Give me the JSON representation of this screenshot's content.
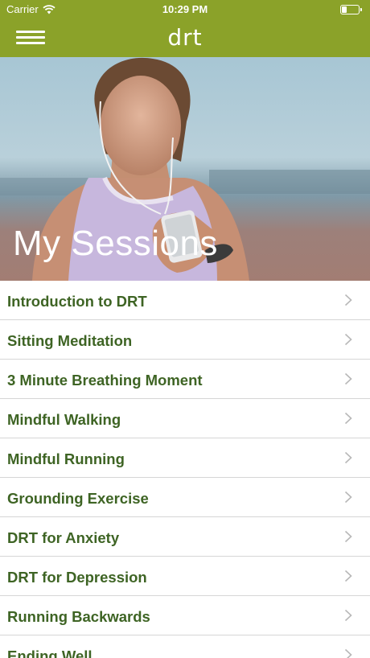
{
  "status_bar": {
    "carrier": "Carrier",
    "time": "10:29 PM",
    "icons": [
      "wifi-icon",
      "battery-icon"
    ]
  },
  "nav": {
    "brand": "drt",
    "menu_icon": "hamburger-menu-icon"
  },
  "hero": {
    "title": "My Sessions"
  },
  "sessions": [
    {
      "label": "Introduction to DRT"
    },
    {
      "label": "Sitting Meditation"
    },
    {
      "label": "3 Minute Breathing Moment"
    },
    {
      "label": "Mindful Walking"
    },
    {
      "label": "Mindful Running"
    },
    {
      "label": "Grounding Exercise"
    },
    {
      "label": "DRT for Anxiety"
    },
    {
      "label": "DRT for Depression"
    },
    {
      "label": "Running Backwards"
    },
    {
      "label": "Ending Well"
    }
  ],
  "colors": {
    "brand_green": "#8ba229",
    "list_text": "#3e6424",
    "chevron": "#b8b8b8"
  }
}
